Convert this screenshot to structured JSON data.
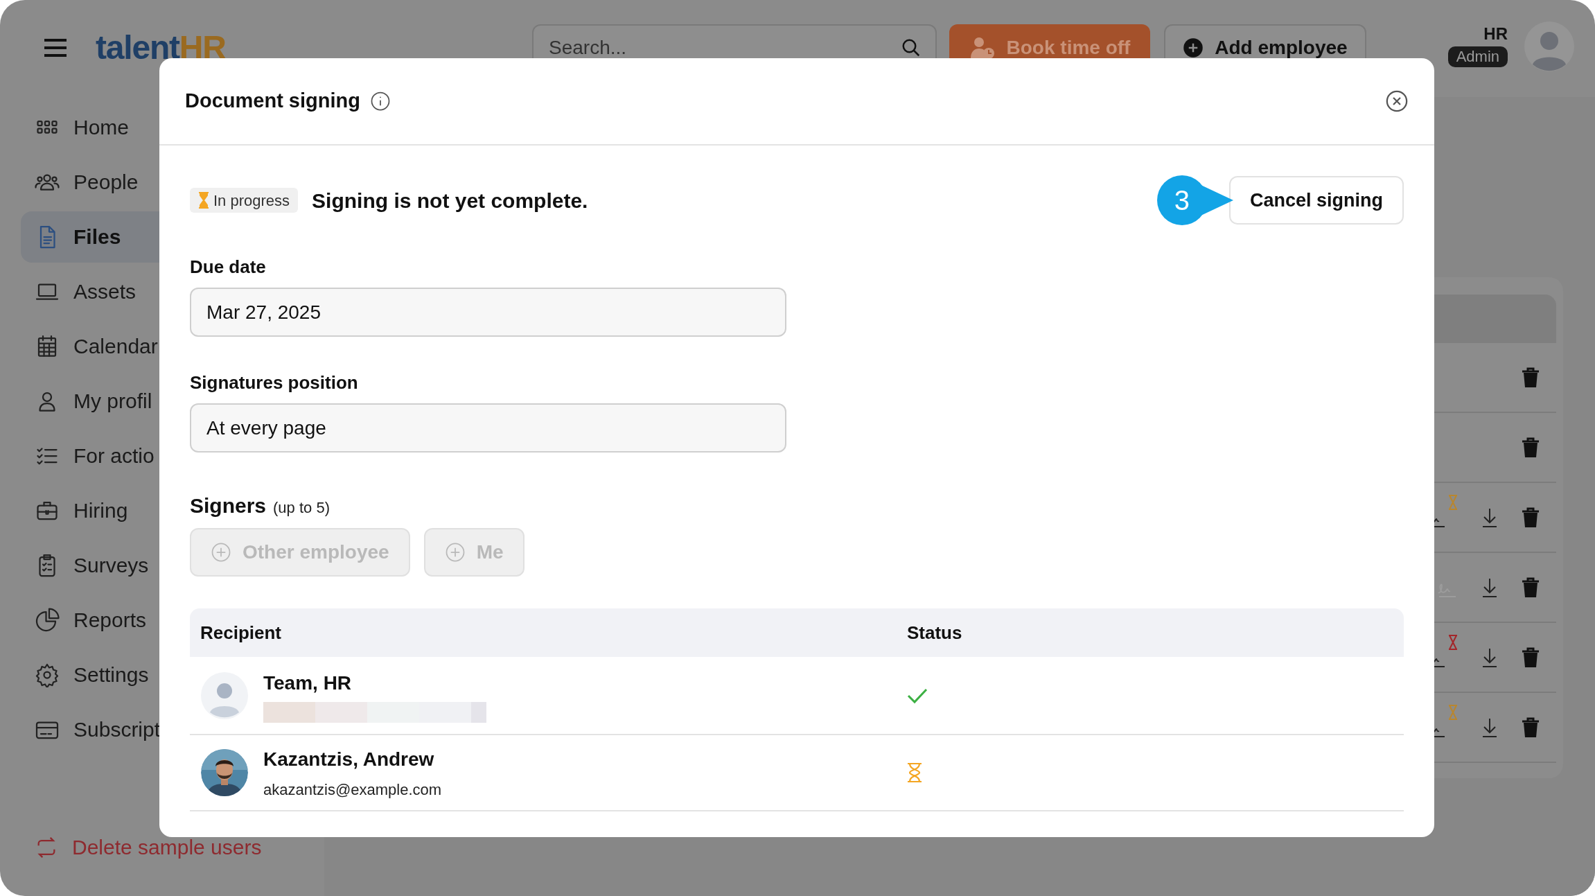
{
  "app": {
    "logo": {
      "main": "talent",
      "accent": "HR"
    },
    "search": {
      "placeholder": "Search..."
    },
    "actions": [
      {
        "label": "Book time off",
        "kind": "primary"
      },
      {
        "label": "Add employee",
        "kind": "secondary"
      }
    ],
    "user": {
      "initials": "HR",
      "role": "Admin"
    }
  },
  "sidebar": {
    "items": [
      {
        "label": "Home",
        "selected": false
      },
      {
        "label": "People",
        "selected": false
      },
      {
        "label": "Files",
        "selected": true
      },
      {
        "label": "Assets",
        "selected": false
      },
      {
        "label": "Calendar",
        "selected": false
      },
      {
        "label": "My profil",
        "selected": false
      },
      {
        "label": "For actio",
        "selected": false
      },
      {
        "label": "Hiring",
        "selected": false
      },
      {
        "label": "Surveys",
        "selected": false
      },
      {
        "label": "Reports",
        "selected": false
      },
      {
        "label": "Settings",
        "selected": false
      },
      {
        "label": "Subscript",
        "selected": false
      }
    ],
    "footer": {
      "label": "Delete sample users"
    }
  },
  "file_rows": [
    {
      "kind": "plain"
    },
    {
      "kind": "plain"
    },
    {
      "kind": "signature",
      "color": "#b8862e"
    },
    {
      "kind": "signature-muted"
    },
    {
      "kind": "signature",
      "color": "#a3262a"
    },
    {
      "kind": "signature",
      "color": "#b8862e"
    }
  ],
  "dialog": {
    "title": "Document signing",
    "status": {
      "badge": "In progress",
      "message": "Signing is not yet complete."
    },
    "callout": "3",
    "cancel_button": "Cancel signing",
    "fields": [
      {
        "label": "Due date",
        "value": "Mar 27, 2025"
      },
      {
        "label": "Signatures position",
        "value": "At every page"
      }
    ],
    "signers": {
      "label": "Signers",
      "hint": "(up to 5)",
      "buttons": [
        {
          "label": "Other employee",
          "disabled": true
        },
        {
          "label": "Me",
          "disabled": true
        }
      ]
    },
    "table": {
      "columns": [
        "Recipient",
        "Status"
      ],
      "rows": [
        {
          "name": "Team, HR",
          "kind": "placeholder-avatar",
          "signed": true
        },
        {
          "name": "Kazantzis, Andrew",
          "email": "akazantzis@example.com",
          "kind": "photo-avatar",
          "signed": false
        }
      ]
    }
  }
}
